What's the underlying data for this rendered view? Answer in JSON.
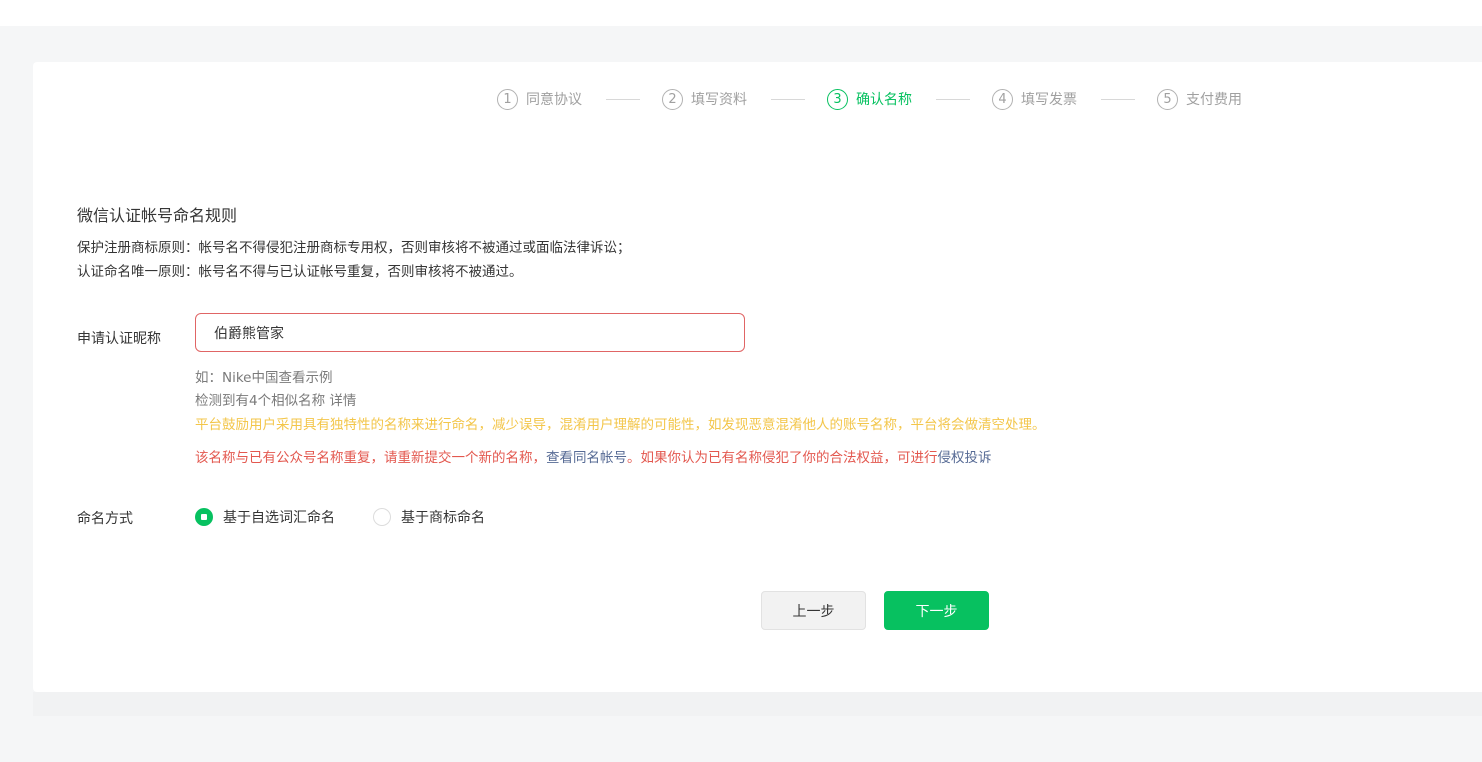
{
  "steps": [
    {
      "num": "1",
      "label": "同意协议"
    },
    {
      "num": "2",
      "label": "填写资料"
    },
    {
      "num": "3",
      "label": "确认名称"
    },
    {
      "num": "4",
      "label": "填写发票"
    },
    {
      "num": "5",
      "label": "支付费用"
    }
  ],
  "rules": {
    "title": "微信认证帐号命名规则",
    "line1": "保护注册商标原则：帐号名不得侵犯注册商标专用权，否则审核将不被通过或面临法律诉讼；",
    "line2": "认证命名唯一原则：帐号名不得与已认证帐号重复，否则审核将不被通过。"
  },
  "nickname": {
    "label": "申请认证昵称",
    "value": "伯爵熊管家",
    "example_prefix": "如：Nike中国",
    "example_link": "查看示例",
    "similar_text": "检测到有4个相似名称",
    "similar_link": "详情",
    "warning": "平台鼓励用户采用具有独特性的名称来进行命名，减少误导，混淆用户理解的可能性，如发现恶意混淆他人的账号名称，平台将会做清空处理。",
    "error_part1": "该名称与已有公众号名称重复，请重新提交一个新的名称，",
    "error_link1": "查看同名帐号",
    "error_part2": "。如果你认为已有名称侵犯了你的合法权益，可进行",
    "error_link2": "侵权投诉"
  },
  "naming": {
    "label": "命名方式",
    "options": [
      {
        "label": "基于自选词汇命名",
        "checked": true
      },
      {
        "label": "基于商标命名",
        "checked": false
      }
    ]
  },
  "buttons": {
    "prev": "上一步",
    "next": "下一步"
  },
  "colors": {
    "accent": "#07c160",
    "error": "#e3584f",
    "warning": "#f3c64a",
    "link": "#576b95"
  }
}
